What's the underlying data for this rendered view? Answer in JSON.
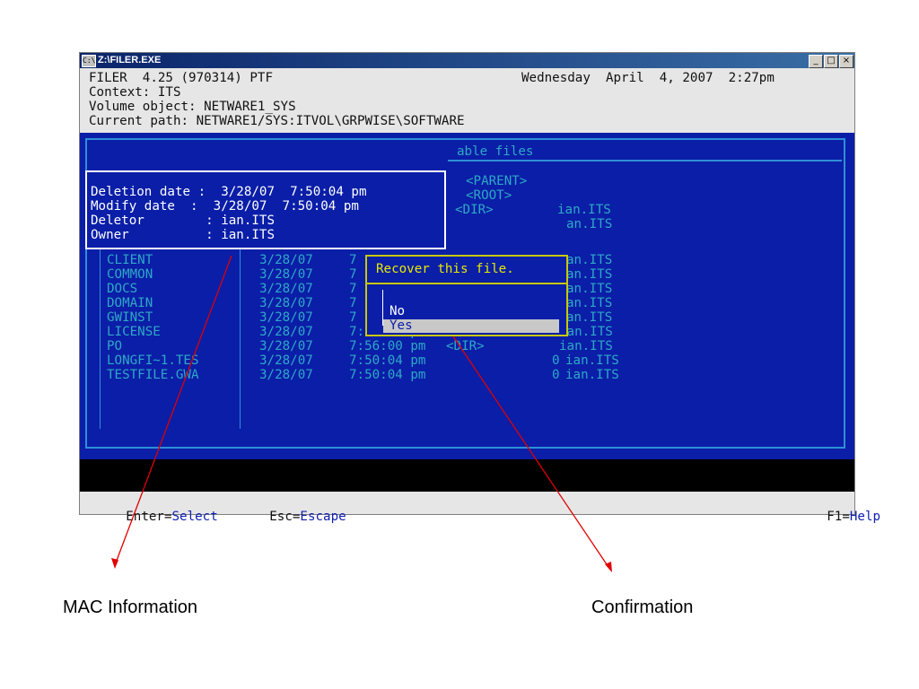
{
  "window": {
    "title": "Z:\\FILER.EXE",
    "buttons": [
      "_",
      "□",
      "×"
    ],
    "icon": "console-icon"
  },
  "header": {
    "line1_left": "FILER  4.25 (970314) PTF",
    "line1_right": "Wednesday  April  4, 2007  2:27pm",
    "line2": "Context: ITS",
    "line3": "Volume object: NETWARE1_SYS",
    "line4": "Current path: NETWARE1/SYS:ITVOL\\GRPWISE\\SOFTWARE"
  },
  "panel_title": "able files",
  "mac_info": {
    "deletion": "Deletion date :  3/28/07  7:50:04 pm",
    "modify": "Modify date  :  3/28/07  7:50:04 pm",
    "deletor": "Deletor        : ian.ITS",
    "owner": "Owner          : ian.ITS"
  },
  "right_entries": [
    {
      "text": "<PARENT>"
    },
    {
      "text": "<ROOT>"
    },
    {
      "text": "<DIR>",
      "owner": "ian.ITS"
    },
    {
      "text": "",
      "owner": "an.ITS"
    }
  ],
  "file_rows": [
    {
      "name": "CLIENT",
      "date": "3/28/07",
      "time": "7",
      "type": "",
      "owner": "an.ITS"
    },
    {
      "name": "COMMON",
      "date": "3/28/07",
      "time": "7",
      "type": "",
      "owner": "an.ITS"
    },
    {
      "name": "DOCS",
      "date": "3/28/07",
      "time": "7",
      "type": "",
      "owner": "an.ITS"
    },
    {
      "name": "DOMAIN",
      "date": "3/28/07",
      "time": "7",
      "type": "",
      "owner": "an.ITS"
    },
    {
      "name": "GWINST",
      "date": "3/28/07",
      "time": "7",
      "type": "",
      "owner": "an.ITS"
    },
    {
      "name": "LICENSE",
      "date": "3/28/07",
      "time": "7:56:10 pm",
      "type": "<DIR>",
      "owner": "ian.ITS"
    },
    {
      "name": "PO",
      "date": "3/28/07",
      "time": "7:56:00 pm",
      "type": "<DIR>",
      "owner": "ian.ITS"
    },
    {
      "name": "LONGFI~1.TES",
      "date": "3/28/07",
      "time": "7:50:04 pm",
      "type": "0",
      "owner": "ian.ITS"
    },
    {
      "name": "TESTFILE.GWA",
      "date": "3/28/07",
      "time": "7:50:04 pm",
      "type": "0",
      "owner": "ian.ITS"
    }
  ],
  "popup": {
    "title": "Recover this file.",
    "options": [
      "No",
      "Yes"
    ],
    "selected": "Yes"
  },
  "status_bar": {
    "enter_key": "Enter=",
    "enter_action": "Select",
    "esc_key": "Esc=",
    "esc_action": "Escape",
    "f1_key": "F1=",
    "f1_action": "Help"
  },
  "annotations": {
    "left_caption": "MAC Information",
    "right_caption": "Confirmation",
    "arrow_color": "#e00000"
  }
}
